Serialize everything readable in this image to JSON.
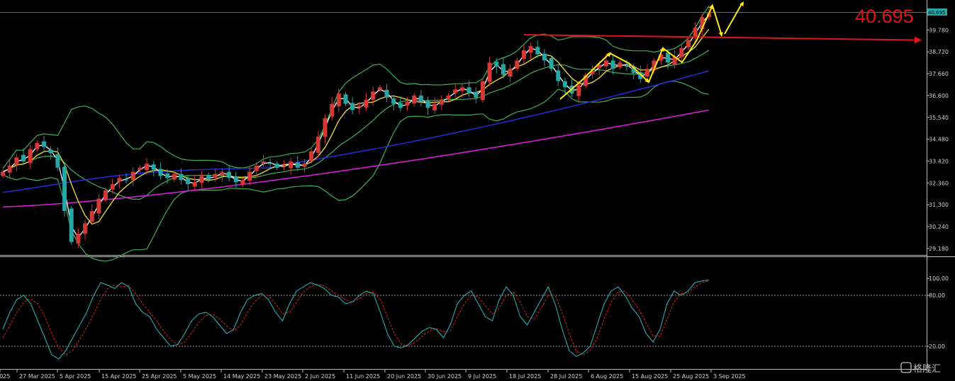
{
  "chart_data": [
    {
      "type": "candlestick",
      "panel": "price",
      "ylim": [
        28.6,
        40.9
      ],
      "y_ticks": [
        "39.780",
        "38.720",
        "37.660",
        "36.600",
        "35.540",
        "34.480",
        "33.420",
        "32.360",
        "31.300",
        "30.240",
        "29.180"
      ],
      "y_tick_values": [
        39.78,
        38.72,
        37.66,
        36.6,
        35.54,
        34.48,
        33.42,
        32.36,
        31.3,
        30.24,
        29.18
      ],
      "current_price_tag": "40.695",
      "current_price": 40.695,
      "annotation_price": "40.695",
      "resistance_level": 39.5,
      "colors": {
        "bull": "#d33a35",
        "bear": "#26a6a4",
        "bb": "#3fae5a",
        "ma_fast": "#ffffff",
        "ma_mid": "#f5e03a",
        "ma_slow": "#2a2ad8",
        "ma_long": "#e21ce0",
        "arrows": "#ffe81a",
        "level": "#e0141b"
      },
      "closes": [
        32.9,
        33.2,
        33.6,
        33.4,
        34.0,
        34.3,
        34.1,
        33.8,
        33.1,
        31.0,
        29.5,
        29.9,
        30.4,
        31.0,
        31.6,
        32.0,
        32.3,
        32.6,
        32.5,
        32.9,
        33.1,
        33.3,
        33.0,
        32.7,
        32.6,
        32.8,
        32.5,
        32.3,
        32.4,
        32.7,
        32.5,
        32.8,
        32.9,
        32.6,
        32.4,
        32.5,
        32.9,
        33.2,
        33.4,
        33.3,
        33.1,
        33.2,
        33.4,
        33.1,
        33.3,
        33.9,
        34.6,
        35.5,
        36.2,
        36.7,
        36.2,
        35.9,
        36.1,
        36.4,
        36.8,
        37.0,
        36.5,
        36.2,
        36.0,
        36.3,
        36.6,
        36.3,
        36.0,
        36.2,
        36.4,
        36.6,
        36.9,
        37.0,
        36.7,
        36.5,
        37.3,
        38.2,
        38.0,
        37.6,
        37.9,
        38.3,
        38.8,
        39.0,
        38.6,
        38.3,
        37.9,
        37.3,
        37.0,
        36.7,
        37.1,
        37.6,
        37.8,
        38.1,
        38.3,
        37.9,
        38.2,
        38.0,
        37.7,
        37.4,
        37.9,
        38.3,
        38.6,
        38.2,
        38.5,
        38.9,
        39.3,
        39.9,
        40.4,
        40.6
      ]
    },
    {
      "type": "line",
      "panel": "oscillator",
      "ylim": [
        0,
        100
      ],
      "y_ticks": [
        "100.00",
        "80.00",
        "20.00"
      ],
      "y_tick_values": [
        100,
        80,
        20
      ],
      "levels": [
        80,
        20
      ],
      "series": [
        {
          "values": [
            40,
            60,
            75,
            80,
            70,
            50,
            30,
            10,
            5,
            15,
            30,
            45,
            60,
            80,
            95,
            92,
            88,
            95,
            90,
            70,
            60,
            55,
            40,
            30,
            20,
            22,
            35,
            50,
            58,
            60,
            55,
            45,
            35,
            40,
            60,
            75,
            80,
            82,
            75,
            60,
            50,
            70,
            85,
            90,
            95,
            92,
            88,
            80,
            78,
            70,
            72,
            80,
            85,
            82,
            60,
            35,
            20,
            18,
            22,
            30,
            38,
            42,
            40,
            30,
            45,
            70,
            80,
            85,
            70,
            55,
            50,
            75,
            90,
            80,
            55,
            45,
            60,
            75,
            90,
            70,
            40,
            15,
            8,
            12,
            20,
            45,
            70,
            85,
            90,
            80,
            65,
            55,
            35,
            25,
            40,
            70,
            85,
            80,
            85,
            95,
            97,
            98
          ]
        },
        {
          "values": [
            30,
            45,
            60,
            72,
            76,
            70,
            55,
            35,
            18,
            10,
            15,
            28,
            42,
            58,
            75,
            88,
            92,
            90,
            91,
            82,
            70,
            60,
            50,
            38,
            28,
            22,
            25,
            36,
            48,
            56,
            58,
            52,
            44,
            38,
            45,
            60,
            72,
            80,
            80,
            70,
            58,
            60,
            72,
            84,
            90,
            93,
            91,
            85,
            80,
            75,
            72,
            76,
            82,
            84,
            75,
            55,
            35,
            22,
            20,
            25,
            32,
            38,
            41,
            37,
            38,
            55,
            70,
            80,
            78,
            68,
            58,
            65,
            80,
            84,
            72,
            55,
            52,
            65,
            80,
            80,
            60,
            35,
            15,
            10,
            15,
            30,
            52,
            72,
            84,
            85,
            75,
            63,
            48,
            32,
            32,
            52,
            72,
            82,
            83,
            90,
            95,
            97
          ]
        }
      ]
    }
  ],
  "x_ticks": [
    "2025",
    "27 Mar 2025",
    "5 Apr 2025",
    "15 Apr 2025",
    "25 Apr 2025",
    "5 May 2025",
    "14 May 2025",
    "23 May 2025",
    "2 Jun 2025",
    "11 Jun 2025",
    "20 Jun 2025",
    "30 Jun 2025",
    "9 Jul 2025",
    "18 Jul 2025",
    "28 Jul 2025",
    "6 Aug 2025",
    "15 Aug 2025",
    "25 Aug 2025",
    "3 Sep 2025"
  ],
  "watermark": "格隆汇"
}
